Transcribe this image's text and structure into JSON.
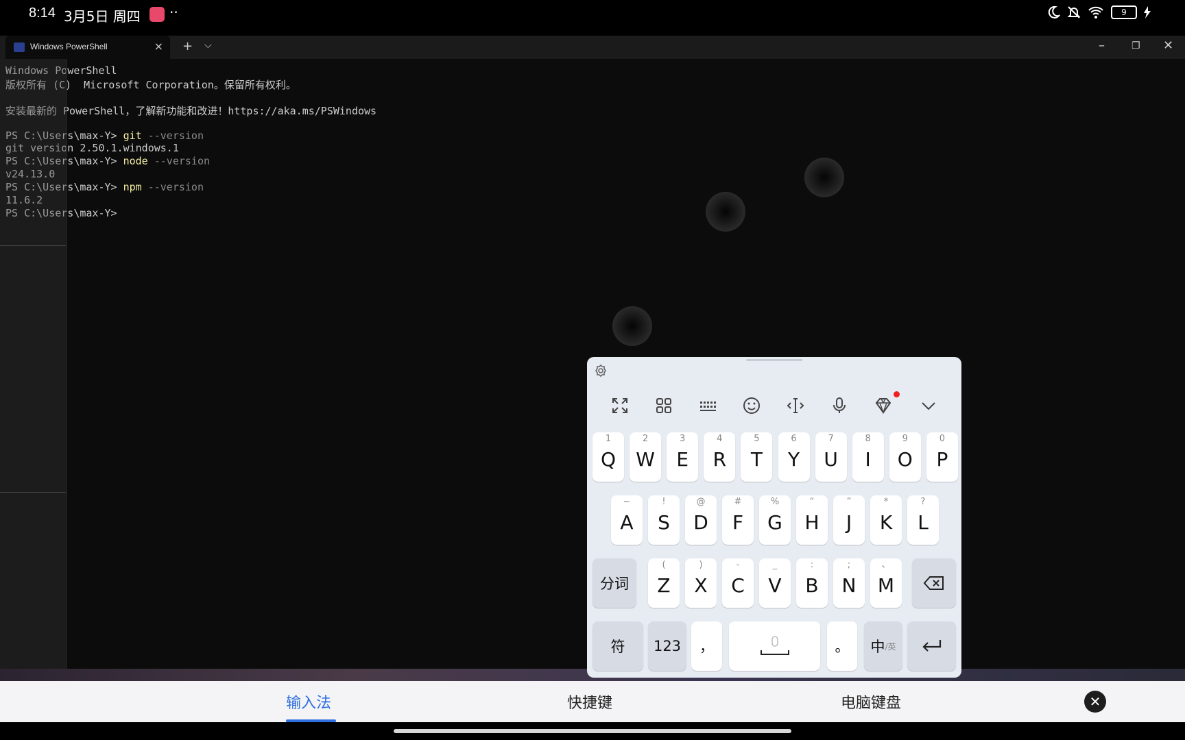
{
  "status_bar": {
    "time": "8:14",
    "date": "3月5日 周四",
    "more": "··",
    "battery": "9"
  },
  "terminal": {
    "tab_title": "Windows PowerShell",
    "lines": [
      {
        "text": "Windows PowerShell"
      },
      {
        "text": "版权所有 (C)  Microsoft Corporation。保留所有权利。"
      },
      {
        "text": ""
      },
      {
        "text": "安装最新的 PowerShell，了解新功能和改进！https://aka.ms/PSWindows"
      },
      {
        "text": ""
      },
      {
        "prompt": "PS C:\\Users\\max-Y> ",
        "cmd": "git",
        "arg": " --version"
      },
      {
        "text": "git version 2.50.1.windows.1"
      },
      {
        "prompt": "PS C:\\Users\\max-Y> ",
        "cmd": "node",
        "arg": " --version"
      },
      {
        "text": "v24.13.0"
      },
      {
        "prompt": "PS C:\\Users\\max-Y> ",
        "cmd": "npm",
        "arg": " --version"
      },
      {
        "text": "11.6.2"
      },
      {
        "prompt": "PS C:\\Users\\max-Y> "
      }
    ]
  },
  "keyboard": {
    "toolbar": [
      "expand-icon",
      "apps-grid-icon",
      "keyboard-layout-icon",
      "emoji-icon",
      "cursor-icon",
      "microphone-icon",
      "diamond-skin-icon",
      "collapse-chevron-icon"
    ],
    "row1": [
      {
        "main": "Q",
        "sub": "1"
      },
      {
        "main": "W",
        "sub": "2"
      },
      {
        "main": "E",
        "sub": "3"
      },
      {
        "main": "R",
        "sub": "4"
      },
      {
        "main": "T",
        "sub": "5"
      },
      {
        "main": "Y",
        "sub": "6"
      },
      {
        "main": "U",
        "sub": "7"
      },
      {
        "main": "I",
        "sub": "8"
      },
      {
        "main": "O",
        "sub": "9"
      },
      {
        "main": "P",
        "sub": "0"
      }
    ],
    "row2": [
      {
        "main": "A",
        "sub": "~"
      },
      {
        "main": "S",
        "sub": "!"
      },
      {
        "main": "D",
        "sub": "@"
      },
      {
        "main": "F",
        "sub": "#"
      },
      {
        "main": "G",
        "sub": "%"
      },
      {
        "main": "H",
        "sub": "“"
      },
      {
        "main": "J",
        "sub": "”"
      },
      {
        "main": "K",
        "sub": "*"
      },
      {
        "main": "L",
        "sub": "?"
      }
    ],
    "row3": [
      {
        "main": "Z",
        "sub": "("
      },
      {
        "main": "X",
        "sub": ")"
      },
      {
        "main": "C",
        "sub": "-"
      },
      {
        "main": "V",
        "sub": "_"
      },
      {
        "main": "B",
        "sub": ":"
      },
      {
        "main": "N",
        "sub": ";"
      },
      {
        "main": "M",
        "sub": "、"
      }
    ],
    "fenci": "分词",
    "symbols": "符",
    "numbers": "123",
    "comma": "，",
    "period": "。",
    "lang_main": "中",
    "lang_sub": "/英"
  },
  "bottom_tabs": {
    "ime": "输入法",
    "shortcuts": "快捷键",
    "pc_keyboard": "电脑键盘"
  }
}
